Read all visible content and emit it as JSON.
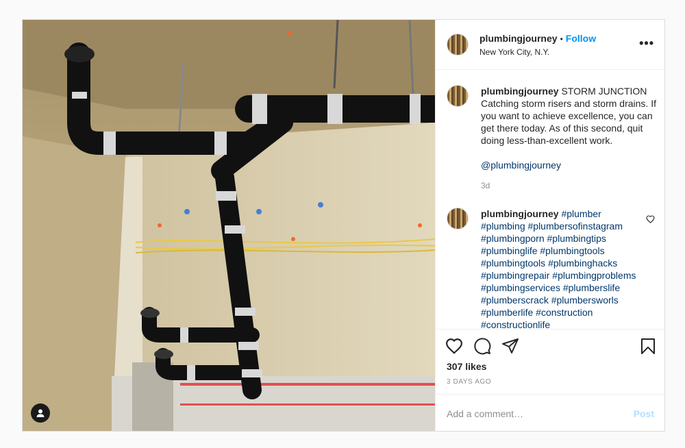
{
  "post": {
    "username": "plumbingjourney",
    "follow_label": "Follow",
    "location": "New York City, N.Y.",
    "more_label": "•••"
  },
  "caption": {
    "username": "plumbingjourney",
    "text": "STORM JUNCTION Catching storm risers and storm drains. If you want to achieve excellence, you can get there today. As of this second, quit doing less-than-excellent work.",
    "mention": "@plumbingjourney",
    "time": "3d"
  },
  "comment": {
    "username": "plumbingjourney",
    "hashtags": [
      "#plumber",
      "#plumbing",
      "#plumbersofinstagram",
      "#plumbingporn",
      "#plumbingtips",
      "#plumbinglife",
      "#plumbingtools",
      "#plumbingtools",
      "#plumbinghacks",
      "#plumbingrepair",
      "#plumbingproblems",
      "#plumbingservices",
      "#plumberslife",
      "#plumberscrack",
      "#plumbersworls",
      "#plumberlife",
      "#construction",
      "#constructionlife"
    ]
  },
  "stats": {
    "likes": "307 likes",
    "time_ago": "3 DAYS AGO"
  },
  "composer": {
    "placeholder": "Add a comment…",
    "post_label": "Post"
  },
  "icons": {
    "like": "heart-icon",
    "comment": "comment-icon",
    "share": "share-icon",
    "save": "bookmark-icon",
    "tags": "user-tag-icon"
  },
  "colors": {
    "accent": "#0095f6",
    "link": "#00376b",
    "muted": "#8e8e8e"
  }
}
